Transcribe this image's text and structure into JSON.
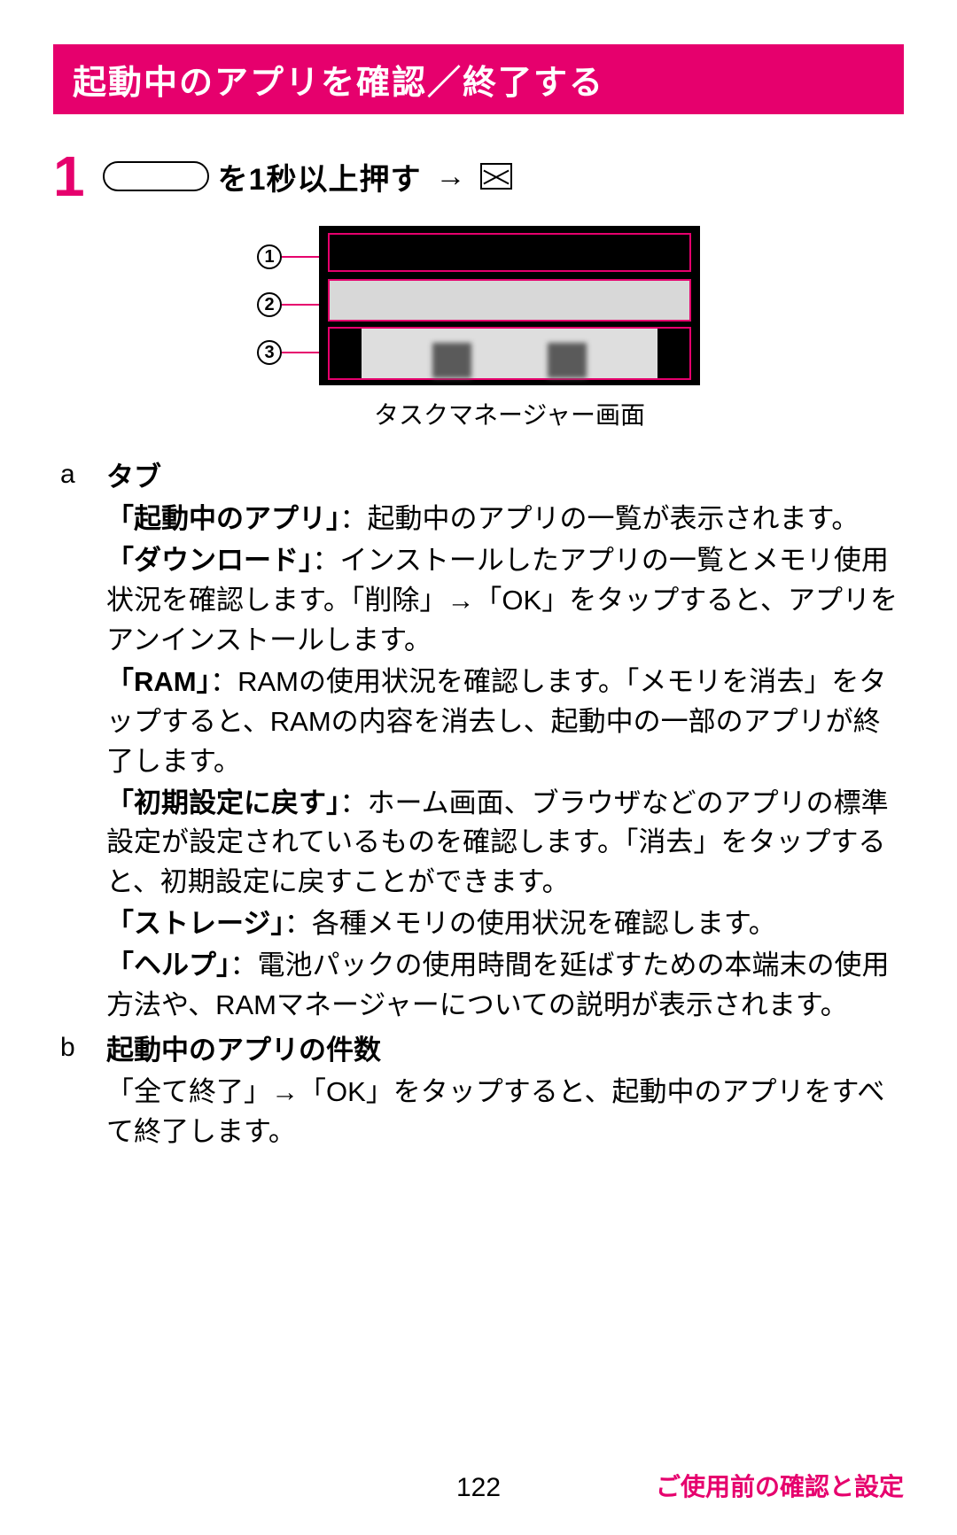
{
  "title": "起動中のアプリを確認／終了する",
  "step": {
    "num": "1",
    "text_a": "を1秒以上押す",
    "arrow": "→"
  },
  "diagram": {
    "callouts": [
      "1",
      "2",
      "3"
    ],
    "caption": "タスクマネージャー画面"
  },
  "items": {
    "a": {
      "letter": "a",
      "title": "タブ",
      "lines": [
        {
          "term": "「起動中のアプリ」",
          "text": "：起動中のアプリの一覧が表示されます。"
        },
        {
          "term": "「ダウンロード」",
          "text": "：インストールしたアプリの一覧とメモリ使用状況を確認します。「削除」→「OK」をタップすると、アプリをアンインストールします。"
        },
        {
          "term": "「RAM」",
          "text": "：RAMの使用状況を確認します。「メモリを消去」をタップすると、RAMの内容を消去し、起動中の一部のアプリが終了します。"
        },
        {
          "term": "「初期設定に戻す」",
          "text": "：ホーム画面、ブラウザなどのアプリの標準設定が設定されているものを確認します。「消去」をタップすると、初期設定に戻すことができます。"
        },
        {
          "term": "「ストレージ」",
          "text": "：各種メモリの使用状況を確認します。"
        },
        {
          "term": "「ヘルプ」",
          "text": "：電池パックの使用時間を延ばすための本端末の使用方法や、RAMマネージャーについての説明が表示されます。"
        }
      ]
    },
    "b": {
      "letter": "b",
      "title": "起動中のアプリの件数",
      "text": "「全て終了」→「OK」をタップすると、起動中のアプリをすべて終了します。"
    }
  },
  "footer": {
    "page": "122",
    "section": "ご使用前の確認と設定"
  }
}
